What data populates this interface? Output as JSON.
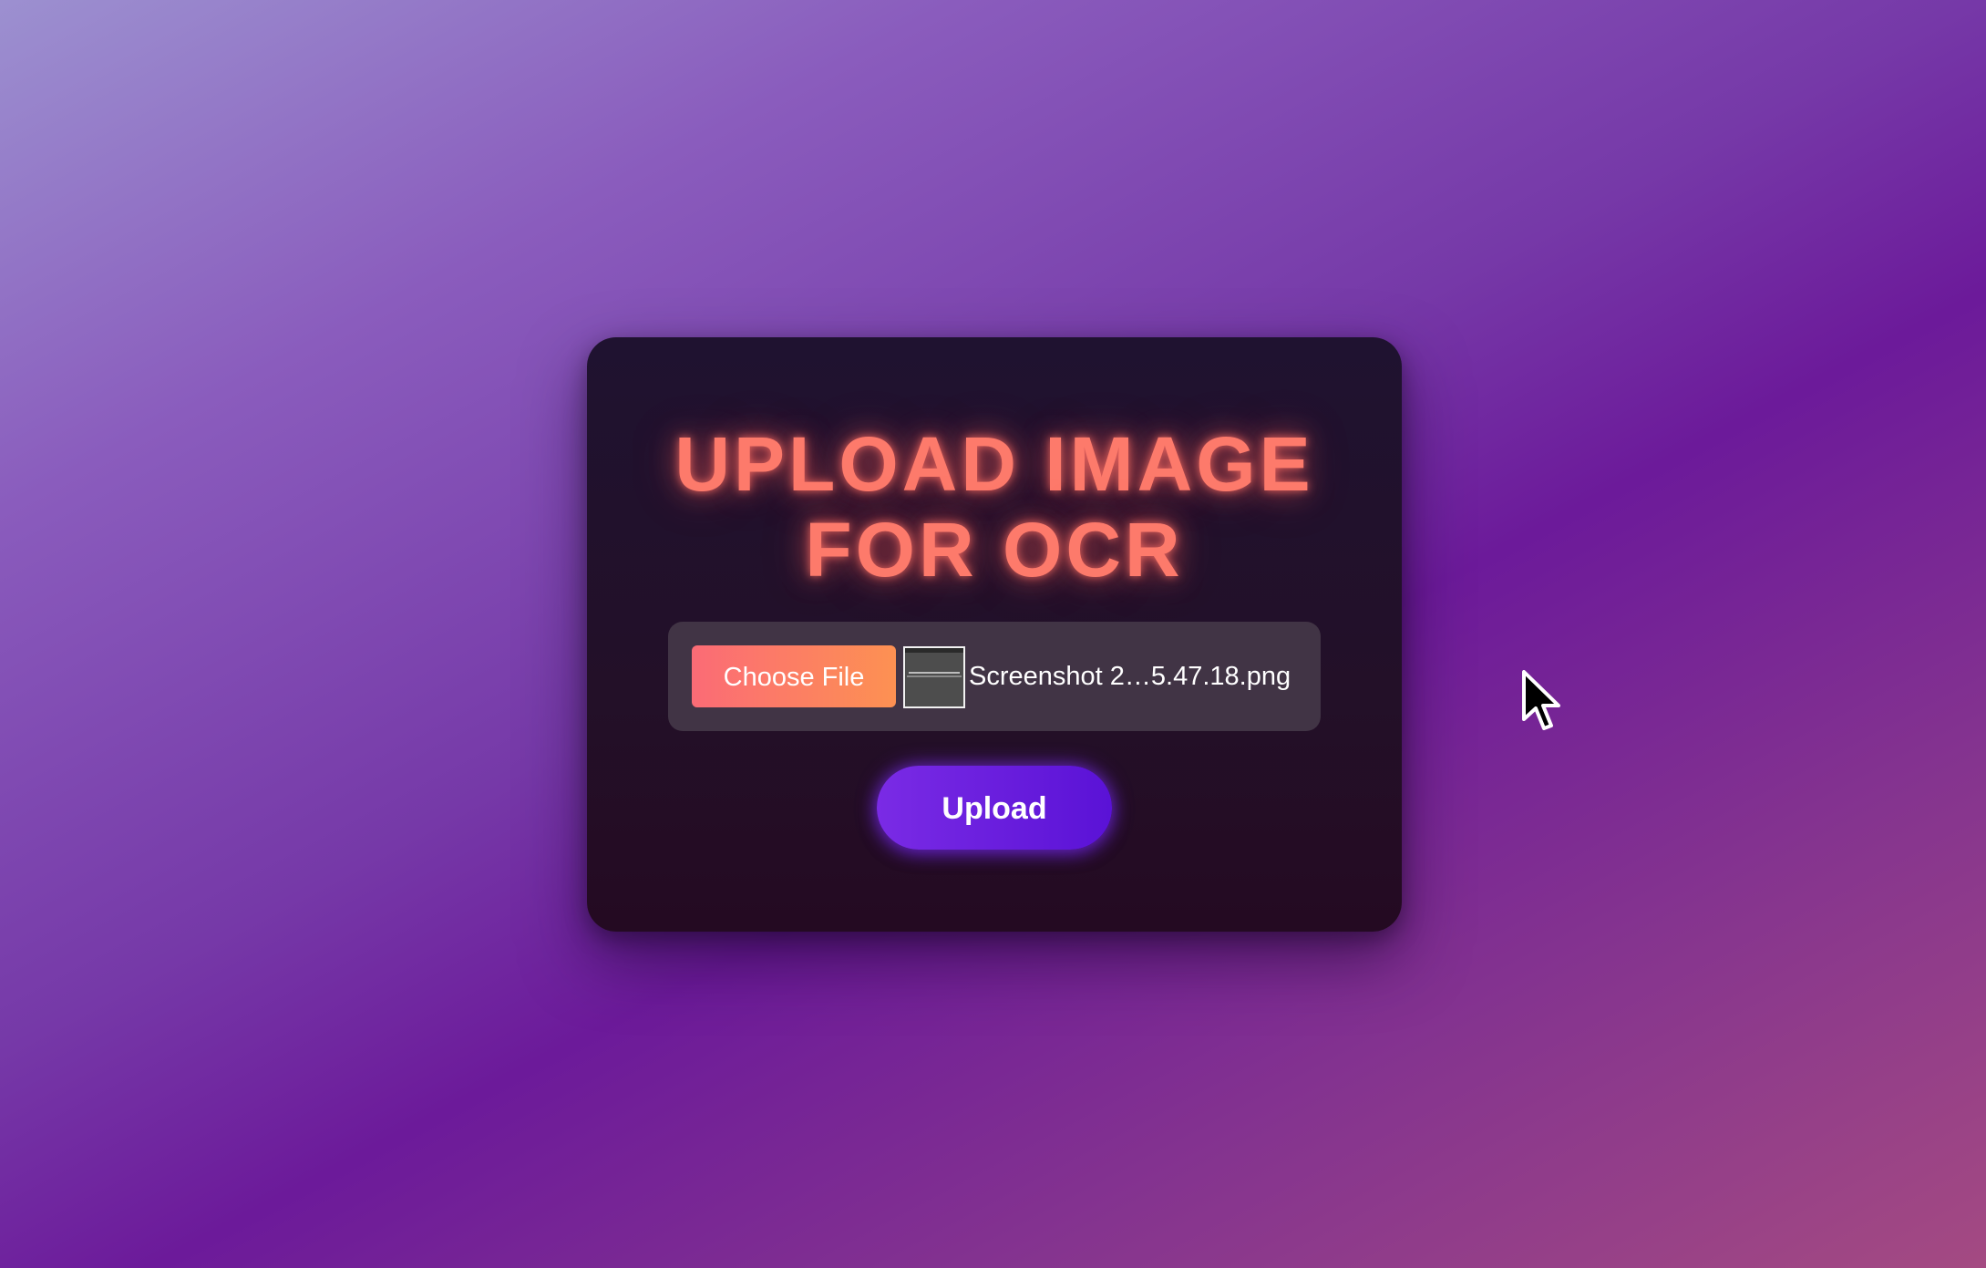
{
  "card": {
    "title_line1": "UPLOAD IMAGE",
    "title_line2": "FOR OCR"
  },
  "file_input": {
    "button_label": "Choose File",
    "selected_file_name": "Screenshot 2…5.47.18.png"
  },
  "upload_button": {
    "label": "Upload"
  },
  "icons": {
    "file_thumbnail": "image-thumbnail-icon",
    "pointer": "mouse-pointer-icon"
  },
  "colors": {
    "title": "#fd7a6b",
    "choose_button_start": "#fb6b76",
    "choose_button_end": "#fd9152",
    "upload_button_start": "#7a2be5",
    "upload_button_end": "#5a12d6",
    "card_background": "#1f1230",
    "file_row_background": "#413445"
  }
}
